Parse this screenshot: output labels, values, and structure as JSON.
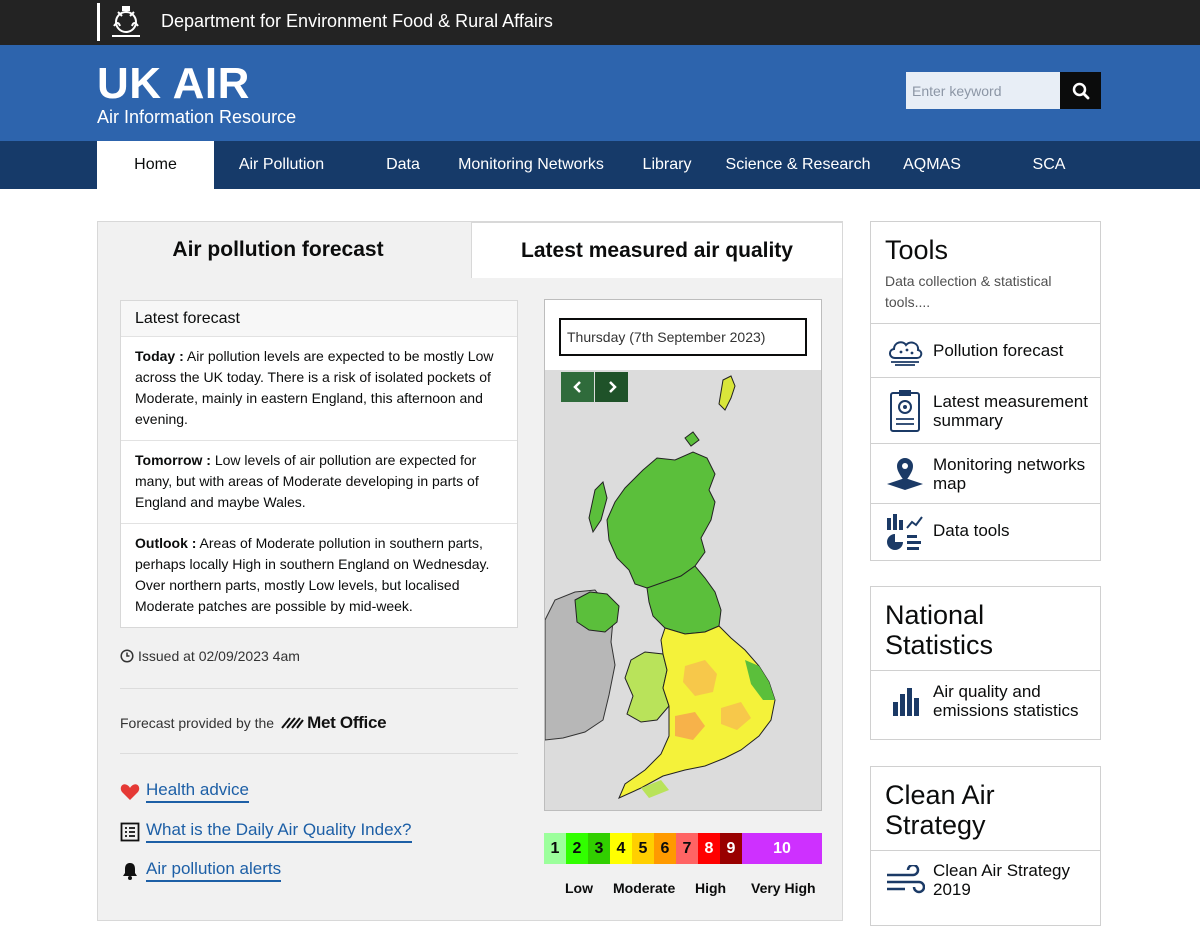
{
  "govbar": {
    "department": "Department for Environment Food & Rural Affairs"
  },
  "header": {
    "title": "UK AIR",
    "subtitle": "Air Information Resource"
  },
  "search": {
    "placeholder": "Enter keyword"
  },
  "nav": {
    "items": [
      {
        "label": "Home",
        "active": true
      },
      {
        "label": "Air Pollution"
      },
      {
        "label": "Data"
      },
      {
        "label": "Monitoring Networks"
      },
      {
        "label": "Library"
      },
      {
        "label": "Science & Research"
      },
      {
        "label": "AQMAS"
      },
      {
        "label": "SCA"
      }
    ]
  },
  "tabs": {
    "forecast": "Air pollution forecast",
    "measured": "Latest measured air quality"
  },
  "forecast": {
    "heading": "Latest forecast",
    "today_label": "Today :",
    "today_text": " Air pollution levels are expected to be mostly Low across the UK today. There is a risk of isolated pockets of Moderate, mainly in eastern England, this afternoon and evening.",
    "tomorrow_label": "Tomorrow :",
    "tomorrow_text": " Low levels of air pollution are expected for many, but with areas of Moderate developing in parts of England and maybe Wales.",
    "outlook_label": "Outlook :",
    "outlook_text": " Areas of Moderate pollution in southern parts, perhaps locally High in southern England on Wednesday. Over northern parts, mostly Low levels, but localised Moderate patches are possible by mid-week.",
    "issued": "Issued at 02/09/2023 4am",
    "provided_by": "Forecast provided by the",
    "provider": "Met Office"
  },
  "links": {
    "health": "Health advice",
    "daqi": "What is the Daily Air Quality Index?",
    "alerts": "Air pollution alerts"
  },
  "map": {
    "date": "Thursday (7th September 2023)"
  },
  "legend": {
    "bands": [
      {
        "value": "1",
        "color": "#9cff9c"
      },
      {
        "value": "2",
        "color": "#31ff00"
      },
      {
        "value": "3",
        "color": "#31cf00"
      },
      {
        "value": "4",
        "color": "#ffff00"
      },
      {
        "value": "5",
        "color": "#ffcf00"
      },
      {
        "value": "6",
        "color": "#ff9a00"
      },
      {
        "value": "7",
        "color": "#ff6464"
      },
      {
        "value": "8",
        "color": "#ff0000"
      },
      {
        "value": "9",
        "color": "#990000"
      },
      {
        "value": "10",
        "color": "#ce30ff"
      }
    ],
    "labels": {
      "low": "Low",
      "moderate": "Moderate",
      "high": "High",
      "very_high": "Very High"
    }
  },
  "tools": {
    "title": "Tools",
    "desc": "Data collection & statistical tools....",
    "items": [
      {
        "label": "Pollution forecast",
        "icon": "cloud-icon"
      },
      {
        "label": "Latest measurement summary",
        "icon": "clipboard-icon"
      },
      {
        "label": "Monitoring networks map",
        "icon": "map-pin-icon"
      },
      {
        "label": "Data tools",
        "icon": "charts-icon"
      }
    ]
  },
  "national": {
    "title": "National Statistics",
    "item": "Air quality and emissions statistics"
  },
  "clean_air": {
    "title": "Clean Air Strategy",
    "item": "Clean Air Strategy 2019"
  },
  "colors": {
    "govbar": "#232323",
    "header": "#2d64ad",
    "nav": "#163a69",
    "link": "#1d5fa6"
  }
}
